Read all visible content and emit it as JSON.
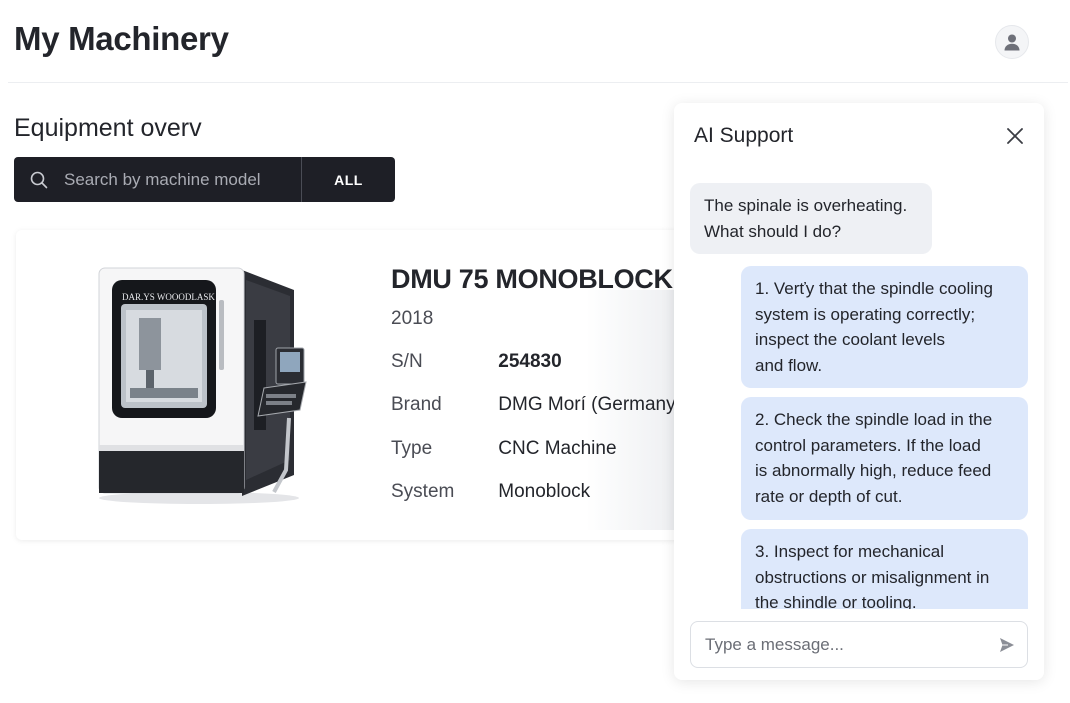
{
  "header": {
    "title": "My Machinery",
    "avatar_icon": "user-icon"
  },
  "main": {
    "section_title": "Equipment overv",
    "search": {
      "placeholder": "Search by machine model",
      "value": "",
      "icon": "search-icon"
    },
    "filter_label": "ALL"
  },
  "machine": {
    "image_label": "DAR.YS WOOODLASK",
    "name": "DMU 75 MONOBLOCK",
    "year": "2018",
    "specs": [
      {
        "label": "S/N",
        "value": "254830"
      },
      {
        "label": "Brand",
        "value": "DMG Morí (Germany"
      },
      {
        "label": "Type",
        "value": "CNC Machine"
      },
      {
        "label": "System",
        "value": "Monoblock"
      }
    ]
  },
  "support": {
    "title": "AI Support",
    "close_icon": "close-icon",
    "messages": [
      {
        "role": "user",
        "text": "The spinale is overheating.\nWhat should I do?"
      },
      {
        "role": "ai",
        "text": "1. Verťy that the spindle cooling\nsystem is operating correctly;\ninspect the coolant levels\nand flow."
      },
      {
        "role": "ai",
        "text": "2. Check the spindle load in the\ncontrol parameters. If the load\nis abnormally high, reduce feed\nrate or depth of cut."
      },
      {
        "role": "ai",
        "text": "3. Inspect for mechanical\nobstructions or misalignment in\nthe shindle or tooling."
      }
    ],
    "composer": {
      "placeholder": "Type a message...",
      "value": "",
      "send_icon": "send-icon"
    }
  },
  "colors": {
    "search_bar_bg": "#1e1f26",
    "ai_bubble_bg": "#dde8fb",
    "user_bubble_bg": "#eef0f4",
    "text_primary": "#23252b"
  }
}
